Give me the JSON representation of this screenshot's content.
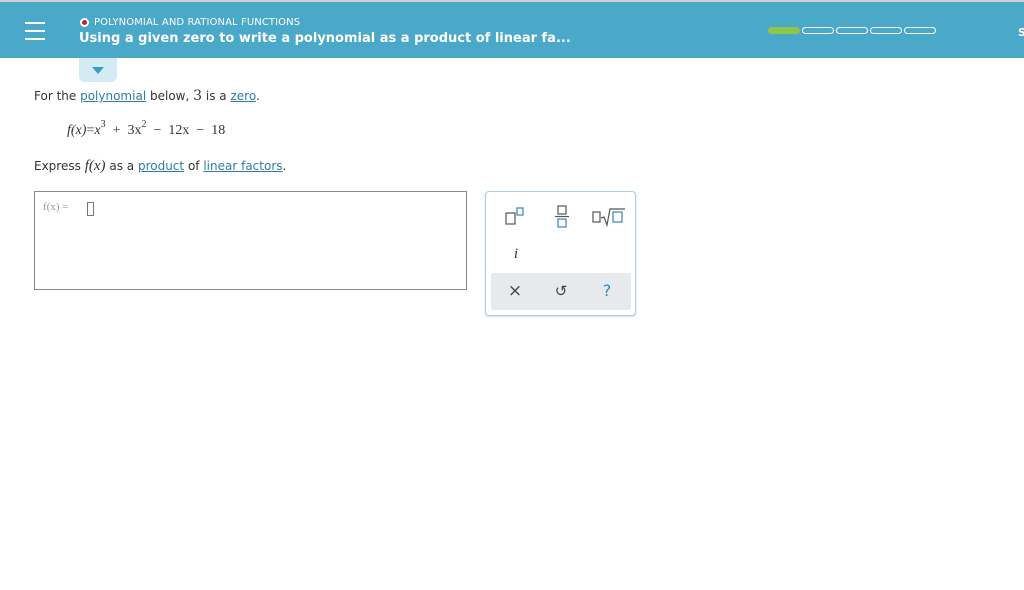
{
  "header": {
    "topic": "POLYNOMIAL AND RATIONAL FUNCTIONS",
    "title": "Using a given zero to write a polynomial as a product of linear fa...",
    "edge_letter": "S",
    "progress": {
      "filled": 1,
      "total": 5
    },
    "accent_color": "#4aa8c8",
    "progress_color": "#8fc549",
    "topic_dot_color": "#c0232c"
  },
  "problem": {
    "line1": {
      "pre": "For the",
      "link1": "polynomial",
      "mid": "below,",
      "zero_value": "3",
      "mid2": "is a",
      "link2": "zero",
      "end": "."
    },
    "equation": {
      "lhs": "f(x)",
      "equals": "=",
      "t1": "x",
      "t1_exp": "3",
      "op1": "+",
      "t2": "3x",
      "t2_exp": "2",
      "op2": "−",
      "t3": "12x",
      "op3": "−",
      "t4": "18"
    },
    "line2": {
      "pre": "Express",
      "func": "f(x)",
      "mid": "as a",
      "link1": "product",
      "mid2": "of",
      "link2": "linear factors",
      "end": "."
    }
  },
  "answer": {
    "label": "f(x) ="
  },
  "keypad": {
    "row1": [
      "superscript-template",
      "fraction-template",
      "sqrt-template"
    ],
    "imag_key": "i",
    "clear_key": "×",
    "undo_key": "↺",
    "help_key": "?"
  }
}
